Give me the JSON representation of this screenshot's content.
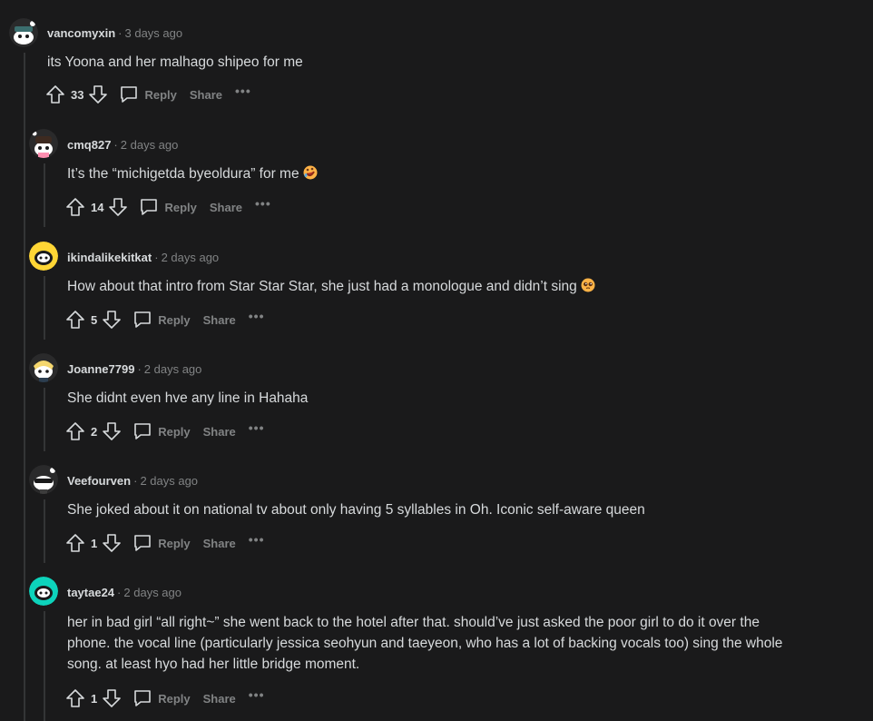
{
  "comments": [
    {
      "username": "vancomyxin",
      "time": "3 days ago",
      "text": "its Yoona and her malhago shipeo for me",
      "score": "33",
      "avatar_color": "#1a1a1b",
      "avatar_icon": "snoo-dark-hat-avatar"
    },
    {
      "username": "cmq827",
      "time": "2 days ago",
      "text": "It’s the “michigetda byeoldura” for me",
      "emoji": "rofl-emoji",
      "score": "14",
      "avatar_color": "#1a1a1b",
      "avatar_icon": "snoo-pink-avatar"
    },
    {
      "username": "ikindalikekitkat",
      "time": "2 days ago",
      "text": "How about that intro from Star Star Star, she just had a monologue and didn’t sing",
      "emoji": "pleading-emoji",
      "score": "5",
      "avatar_color": "#ffd635",
      "avatar_icon": "snoo-yellow-avatar"
    },
    {
      "username": "Joanne7799",
      "time": "2 days ago",
      "text": "She didnt even hve any line in Hahaha",
      "score": "2",
      "avatar_color": "#1a1a1b",
      "avatar_icon": "snoo-blonde-avatar"
    },
    {
      "username": "Veefourven",
      "time": "2 days ago",
      "text": "She joked about it on national tv about only having 5 syllables in Oh. Iconic self-aware queen",
      "score": "1",
      "avatar_color": "#1a1a1b",
      "avatar_icon": "snoo-sunglasses-avatar"
    },
    {
      "username": "taytae24",
      "time": "2 days ago",
      "text_lines": [
        "her in bad girl “all right~” she went back to the hotel after that. should’ve just asked the poor girl to do it over the",
        "phone. the vocal line (particularly jessica seohyun and taeyeon, who has a lot of backing vocals too) sing the whole",
        "song. at least hyo had her little bridge moment."
      ],
      "score": "1",
      "avatar_color": "#0dd3bb",
      "avatar_icon": "snoo-teal-avatar"
    }
  ],
  "actions": {
    "reply_label": "Reply",
    "share_label": "Share",
    "more_label": "•••"
  },
  "separator": "·"
}
